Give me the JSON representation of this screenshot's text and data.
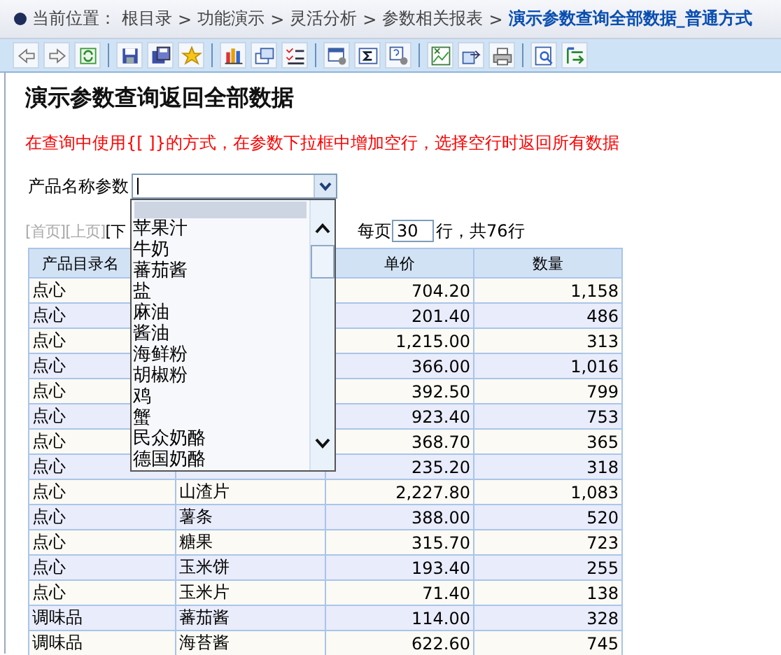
{
  "breadcrumb": {
    "label": "当前位置：",
    "crumbs": [
      {
        "label": "根目录",
        "current": false
      },
      {
        "sep": ">",
        "label": "功能演示",
        "current": false
      },
      {
        "sep": ">",
        "label": "灵活分析",
        "current": false
      },
      {
        "sep": ">",
        "label": "参数相关报表",
        "current": false
      },
      {
        "sep": ">",
        "label": "演示参数查询全部数据_普通方式",
        "current": true
      }
    ]
  },
  "report": {
    "title": "演示参数查询返回全部数据",
    "note": "在查询中使用{[ ]}的方式，在参数下拉框中增加空行，选择空行时返回所有数据",
    "param": {
      "label": "产品名称参数",
      "expanded": true,
      "options": [
        {
          "kind": "blank",
          "selected": true
        },
        {
          "label": "苹果汁",
          "selected": false
        },
        {
          "label": "牛奶",
          "selected": false
        },
        {
          "label": "蕃茄酱",
          "selected": false
        },
        {
          "label": "盐",
          "selected": false
        },
        {
          "label": "麻油",
          "selected": false
        },
        {
          "label": "酱油",
          "selected": false
        },
        {
          "label": "海鲜粉",
          "selected": false
        },
        {
          "label": "胡椒粉",
          "selected": false
        },
        {
          "label": "鸡",
          "selected": false
        },
        {
          "label": "蟹",
          "selected": false
        },
        {
          "label": "民众奶酪",
          "selected": false
        },
        {
          "label": "德国奶酪",
          "selected": false
        }
      ]
    },
    "pager": {
      "links": [
        {
          "label": "[首页]",
          "disabled": true
        },
        {
          "label": "[上页]",
          "disabled": true
        },
        {
          "label": "[下",
          "disabled": false
        }
      ],
      "per_page_label": "每页",
      "per_page": "30",
      "total": "行，共76行"
    },
    "table": {
      "columns": [
        "产品目录名",
        null,
        "单价",
        "数量"
      ],
      "rows": [
        [
          "点心",
          null,
          "704.20",
          "1,158"
        ],
        [
          "点心",
          null,
          "201.40",
          "486"
        ],
        [
          "点心",
          null,
          "1,215.00",
          "313"
        ],
        [
          "点心",
          null,
          "366.00",
          "1,016"
        ],
        [
          "点心",
          null,
          "392.50",
          "799"
        ],
        [
          "点心",
          null,
          "923.40",
          "753"
        ],
        [
          "点心",
          null,
          "368.70",
          "365"
        ],
        [
          "点心",
          null,
          "235.20",
          "318"
        ],
        [
          "点心",
          "山渣片",
          "2,227.80",
          "1,083"
        ],
        [
          "点心",
          "薯条",
          "388.00",
          "520"
        ],
        [
          "点心",
          "糖果",
          "315.70",
          "723"
        ],
        [
          "点心",
          "玉米饼",
          "193.40",
          "255"
        ],
        [
          "点心",
          "玉米片",
          "71.40",
          "138"
        ],
        [
          "调味品",
          "蕃茄酱",
          "114.00",
          "328"
        ],
        [
          "调味品",
          "海苔酱",
          "622.60",
          "745"
        ]
      ]
    }
  }
}
